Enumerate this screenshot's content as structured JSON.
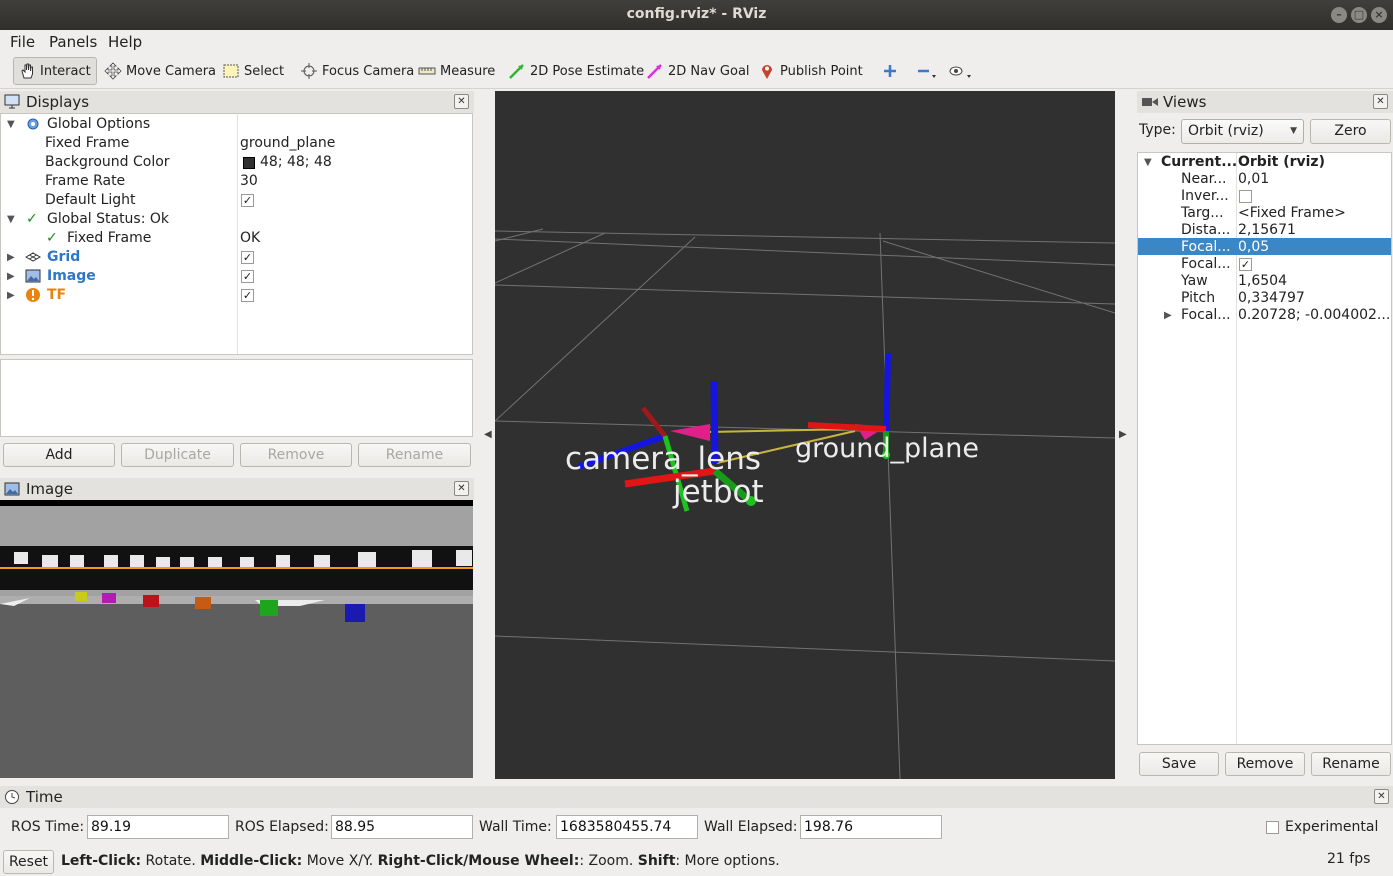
{
  "window": {
    "title": "config.rviz* - RViz",
    "minimize": "–",
    "maximize": "□",
    "close": "×"
  },
  "menu": [
    "File",
    "Panels",
    "Help"
  ],
  "toolbar": {
    "interact": "Interact",
    "move_camera": "Move Camera",
    "select": "Select",
    "focus_camera": "Focus Camera",
    "measure": "Measure",
    "pose_estimate": "2D Pose Estimate",
    "nav_goal": "2D Nav Goal",
    "publish_point": "Publish Point"
  },
  "displays": {
    "title": "Displays",
    "rows": [
      {
        "name": "Global Options",
        "value": ""
      },
      {
        "name": "Fixed Frame",
        "value": "ground_plane"
      },
      {
        "name": "Background Color",
        "value": "48; 48; 48"
      },
      {
        "name": "Frame Rate",
        "value": "30"
      },
      {
        "name": "Default Light",
        "value": "✓"
      },
      {
        "name": "Global Status: Ok",
        "value": ""
      },
      {
        "name": "Fixed Frame",
        "value": "OK"
      },
      {
        "name": "Grid",
        "value": "✓"
      },
      {
        "name": "Image",
        "value": "✓"
      },
      {
        "name": "TF",
        "value": "✓"
      }
    ],
    "buttons": {
      "add": "Add",
      "duplicate": "Duplicate",
      "remove": "Remove",
      "rename": "Rename"
    }
  },
  "image_panel": {
    "title": "Image"
  },
  "viewport": {
    "labels": {
      "camera_lens": "camera_lens",
      "ground_plane": "ground_plane",
      "jetbot": "jetbot"
    }
  },
  "views": {
    "title": "Views",
    "type_label": "Type:",
    "type_value": "Orbit (rviz)",
    "zero": "Zero",
    "rows": [
      {
        "name": "Current...",
        "value": "Orbit (rviz)"
      },
      {
        "name": "Near...",
        "value": "0,01"
      },
      {
        "name": "Inver...",
        "value": ""
      },
      {
        "name": "Targ...",
        "value": "<Fixed Frame>"
      },
      {
        "name": "Dista...",
        "value": "2,15671"
      },
      {
        "name": "Focal...",
        "value": "0,05"
      },
      {
        "name": "Focal...",
        "value": "✓"
      },
      {
        "name": "Yaw",
        "value": "1,6504"
      },
      {
        "name": "Pitch",
        "value": "0,334797"
      },
      {
        "name": "Focal...",
        "value": "0.20728; -0.004002..."
      }
    ],
    "buttons": {
      "save": "Save",
      "remove": "Remove",
      "rename": "Rename"
    }
  },
  "time": {
    "title": "Time",
    "ros_time_label": "ROS Time:",
    "ros_time": "89.19",
    "ros_elapsed_label": "ROS Elapsed:",
    "ros_elapsed": "88.95",
    "wall_time_label": "Wall Time:",
    "wall_time": "1683580455.74",
    "wall_elapsed_label": "Wall Elapsed:",
    "wall_elapsed": "198.76",
    "experimental": "Experimental"
  },
  "status": {
    "reset": "Reset",
    "left_click": "Left-Click:",
    "left_click_desc": " Rotate. ",
    "middle_click": "Middle-Click:",
    "middle_click_desc": " Move X/Y. ",
    "right_click": "Right-Click/Mouse Wheel:",
    "right_click_desc": ": Zoom. ",
    "shift": "Shift",
    "shift_desc": ": More options.",
    "fps": "21 fps"
  },
  "colors": {
    "viewport_bg": "#303030",
    "selected_row": "#3a87c7",
    "link_blue": "#2e76c7",
    "tf_orange": "#e9830d"
  }
}
